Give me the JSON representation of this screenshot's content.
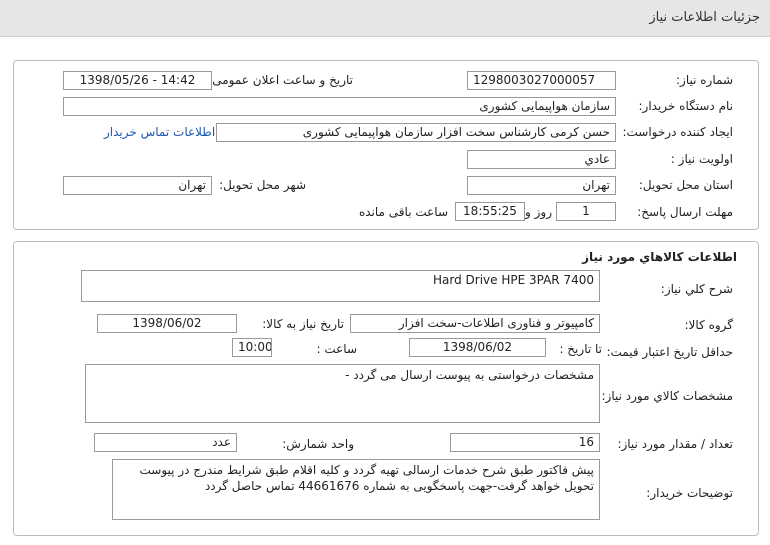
{
  "header": {
    "title": "جزئیات اطلاعات نیاز"
  },
  "need_info": {
    "need_number_label": "شماره نیاز:",
    "need_number": "1298003027000057",
    "announce_datetime_label": "تاریخ و ساعت اعلان عمومی:",
    "announce_datetime": "1398/05/26 - 14:42",
    "buyer_org_label": "نام دستگاه خریدار:",
    "buyer_org": "سازمان هواپیمایی کشوری",
    "requester_label": "ایجاد کننده درخواست:",
    "requester": "حسن کرمی کارشناس سخت افزار سازمان هواپیمایی کشوری",
    "contact_link": "اطلاعات تماس خریدار",
    "priority_label": "اولویت نیاز :",
    "priority": "عادي",
    "delivery_province_label": "استان محل تحویل:",
    "delivery_province": "تهران",
    "delivery_city_label": "شهر محل تحویل:",
    "delivery_city": "تهران",
    "reply_deadline_label": "مهلت ارسال پاسخ:",
    "days": "1",
    "days_suffix": "روز و",
    "time_remaining": "18:55:25",
    "time_remaining_suffix": "ساعت باقی مانده"
  },
  "goods_info": {
    "section_title": "اطلاعات کالاهاي مورد نياز",
    "general_desc_label": "شرح کلي نياز:",
    "general_desc": "Hard Drive HPE 3PAR 7400",
    "goods_group_label": "گروه کالا:",
    "goods_group": "کامپيوتر و فناوری اطلاعات-سخت افزار",
    "need_date_label": "تاريخ نياز به کالا:",
    "need_date": "1398/06/02",
    "price_validity_label": "حداقل تاريخ اعتبار قيمت:",
    "until_date_label": "تا تاريخ :",
    "until_date": "1398/06/02",
    "hour_label": "ساعت :",
    "hour": "10:00",
    "goods_spec_label": "مشخصات کالاي مورد نياز:",
    "goods_spec": "مشخصات درخواستی به پیوست ارسال می گردد -",
    "quantity_label": "تعداد / مقدار مورد نياز:",
    "quantity": "16",
    "unit_label": "واحد شمارش:",
    "unit": "عدد",
    "buyer_notes_label": "توضيحات خريدار:",
    "buyer_notes": "پیش فاکتور طبق شرح خدمات ارسالی تهیه گردد و کلیه اقلام طبق شرایط مندرج در پیوست تحویل خواهد گرفت-جهت پاسخگویی به شماره 44661676 تماس حاصل گردد"
  }
}
